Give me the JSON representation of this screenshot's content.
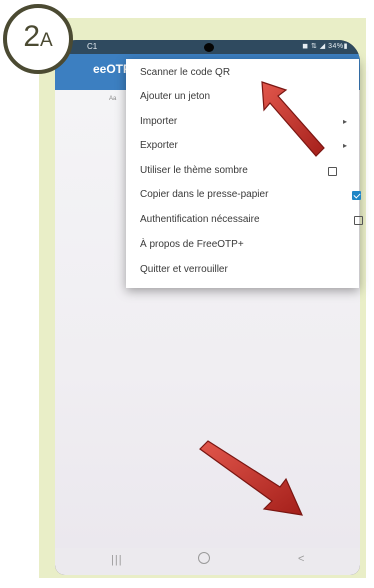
{
  "badge": {
    "number": "2",
    "letter": "A"
  },
  "status_bar": {
    "time": "C1",
    "icons": "◼ ⇅ ◢ 34%▮"
  },
  "app": {
    "title": "eeOTP",
    "subtitle": "Aa"
  },
  "menu": {
    "items": [
      {
        "label": "Scanner le code QR",
        "control": "none"
      },
      {
        "label": "Ajouter un jeton",
        "control": "none"
      },
      {
        "label": "Importer",
        "control": "submenu"
      },
      {
        "label": "Exporter",
        "control": "submenu"
      },
      {
        "label": "Utiliser le thème sombre",
        "control": "checkbox",
        "checked": false
      },
      {
        "label": "Copier dans le presse-papier",
        "control": "checkbox",
        "checked": true
      },
      {
        "label": "Authentification nécessaire",
        "control": "checkbox",
        "checked": false
      },
      {
        "label": "À propos de FreeOTP+",
        "control": "none"
      },
      {
        "label": "Quitter et verrouiller",
        "control": "none"
      }
    ],
    "submenu_glyph": "▸"
  },
  "nav": {
    "recent": "|||",
    "back": "<"
  },
  "fab": {
    "icon": "camera-icon",
    "color": "#1f86c6"
  },
  "colors": {
    "frame": "#e9eec7",
    "appbar": "#3c7fc1",
    "arrow": "#c8302a",
    "badge_border": "#4b4a32"
  }
}
